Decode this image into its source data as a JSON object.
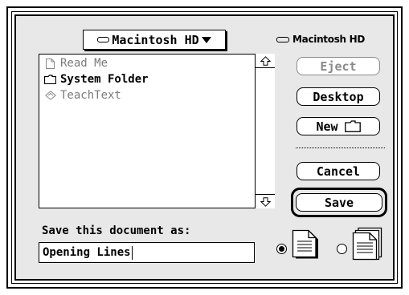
{
  "popup": {
    "disk": "Macintosh HD"
  },
  "volume": {
    "name": "Macintosh HD"
  },
  "files": [
    {
      "name": "Read Me",
      "icon": "document-icon",
      "enabled": false
    },
    {
      "name": "System Folder",
      "icon": "folder-icon",
      "enabled": true
    },
    {
      "name": "TeachText",
      "icon": "application-icon",
      "enabled": false
    }
  ],
  "buttons": {
    "eject": "Eject",
    "desktop": "Desktop",
    "new": "New",
    "cancel": "Cancel",
    "save": "Save"
  },
  "save_as": {
    "label": "Save this document as:",
    "value": "Opening Lines"
  },
  "format": {
    "selected": "text-document"
  }
}
